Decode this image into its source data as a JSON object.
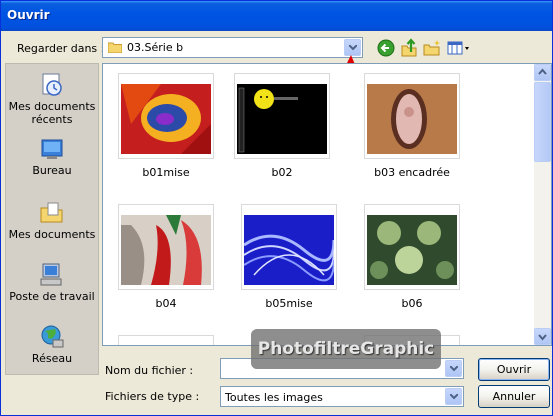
{
  "window": {
    "title": "Ouvrir"
  },
  "lookin": {
    "label": "Regarder dans :",
    "value": "03.Série b"
  },
  "toolbar": {
    "back_icon": "back-arrow-icon",
    "up_icon": "up-folder-icon",
    "new_folder_icon": "new-folder-icon",
    "views_icon": "views-menu-icon"
  },
  "places": [
    {
      "label": "Mes documents récents",
      "icon": "recent-documents-icon"
    },
    {
      "label": "Bureau",
      "icon": "desktop-icon"
    },
    {
      "label": "Mes documents",
      "icon": "my-documents-icon"
    },
    {
      "label": "Poste de travail",
      "icon": "my-computer-icon"
    },
    {
      "label": "Réseau",
      "icon": "network-icon"
    }
  ],
  "files": [
    {
      "name": "b01mise"
    },
    {
      "name": "b02"
    },
    {
      "name": "b03 encadrée"
    },
    {
      "name": "b04"
    },
    {
      "name": "b05mise"
    },
    {
      "name": "b06"
    }
  ],
  "form": {
    "filename_label": "Nom du fichier :",
    "filename_value": "",
    "filetype_label": "Fichiers de type :",
    "filetype_value": "Toutes les images"
  },
  "buttons": {
    "open": "Ouvrir",
    "cancel": "Annuler"
  },
  "watermark": "PhotofiltreGraphic",
  "colors": {
    "titlebar": "#0054e3",
    "dialog_bg": "#ece9d8",
    "annotation_arrow": "#e00000"
  }
}
